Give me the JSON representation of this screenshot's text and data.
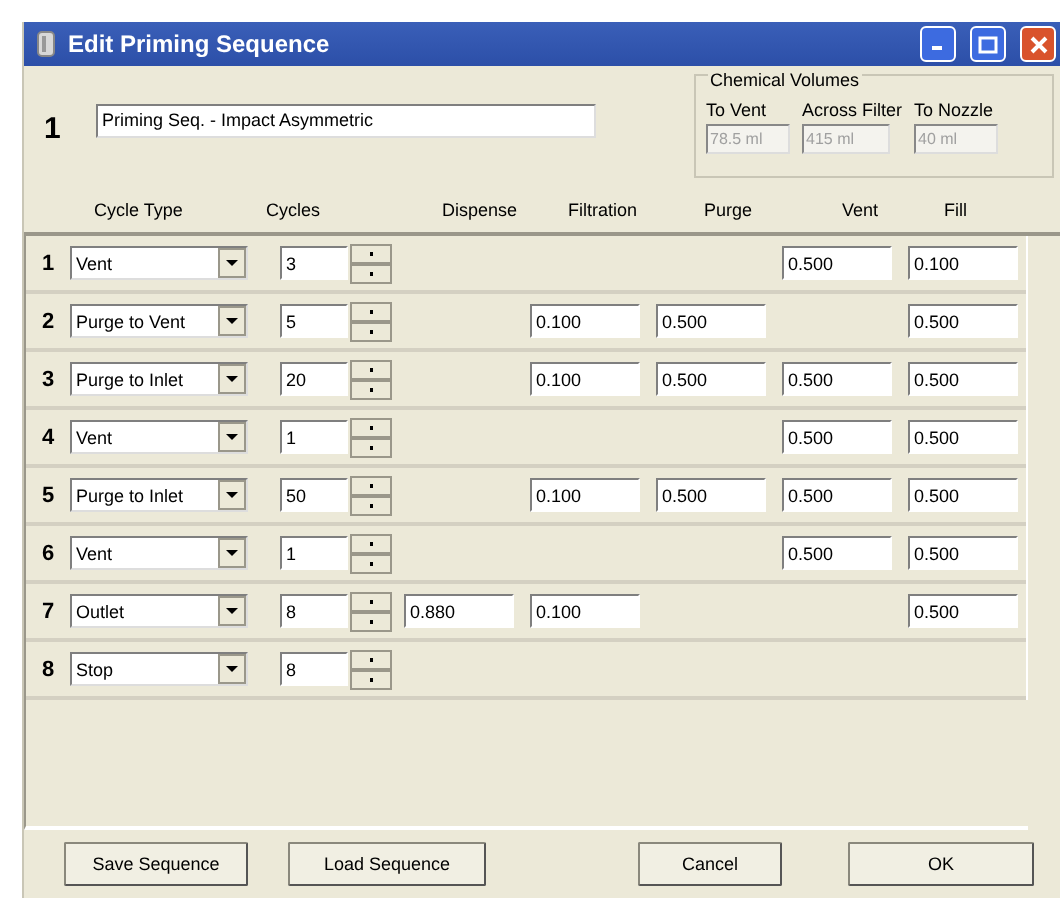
{
  "window": {
    "title": "Edit Priming Sequence"
  },
  "sequence": {
    "number": "1",
    "name": "Priming Seq. - Impact Asymmetric"
  },
  "chemical_volumes": {
    "title": "Chemical Volumes",
    "items": [
      {
        "label": "To Vent",
        "value": "78.5 ml",
        "disabled": true
      },
      {
        "label": "Across Filter",
        "value": "415 ml",
        "disabled": true
      },
      {
        "label": "To Nozzle",
        "value": "40 ml",
        "disabled": true
      }
    ]
  },
  "columns": [
    "Cycle Type",
    "Cycles",
    "Dispense",
    "Filtration",
    "Purge",
    "Vent",
    "Fill"
  ],
  "rows": [
    {
      "number": "1",
      "cycle_type": "Vent",
      "cycles": "3",
      "vent": "0.500",
      "fill": "0.100"
    },
    {
      "number": "2",
      "cycle_type": "Purge to Vent",
      "cycles": "5",
      "filtration": "0.100",
      "purge": "0.500",
      "fill": "0.500"
    },
    {
      "number": "3",
      "cycle_type": "Purge to Inlet",
      "cycles": "20",
      "filtration": "0.100",
      "purge": "0.500",
      "vent": "0.500",
      "fill": "0.500"
    },
    {
      "number": "4",
      "cycle_type": "Vent",
      "cycles": "1",
      "vent": "0.500",
      "fill": "0.500"
    },
    {
      "number": "5",
      "cycle_type": "Purge to Inlet",
      "cycles": "50",
      "filtration": "0.100",
      "purge": "0.500",
      "vent": "0.500",
      "fill": "0.500"
    },
    {
      "number": "6",
      "cycle_type": "Vent",
      "cycles": "1",
      "vent": "0.500",
      "fill": "0.500"
    },
    {
      "number": "7",
      "cycle_type": "Outlet",
      "cycles": "8",
      "dispense": "0.880",
      "filtration": "0.100",
      "fill": "0.500"
    },
    {
      "number": "8",
      "cycle_type": "Stop",
      "cycles": "8"
    }
  ],
  "buttons": [
    "Save Sequence",
    "Load Sequence",
    "Cancel",
    "OK"
  ]
}
